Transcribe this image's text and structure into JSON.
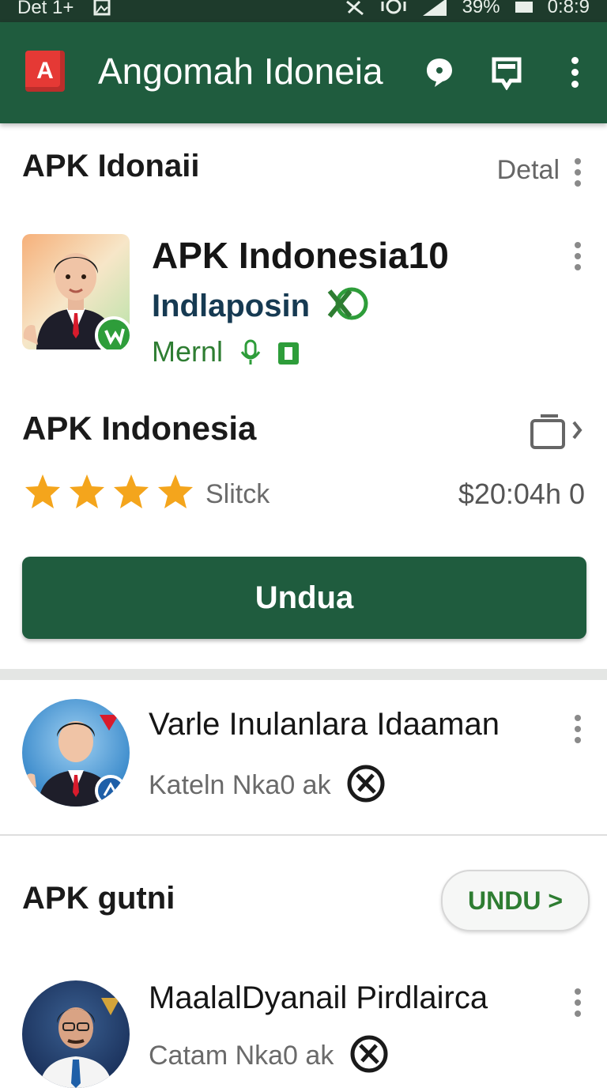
{
  "status_bar": {
    "carrier": "Det 1+",
    "battery": "39%",
    "time": "0:8:9"
  },
  "app_bar": {
    "logo_letter": "A",
    "title": "Angomah Idoneia",
    "icons": [
      "chat-icon",
      "bookmark-icon",
      "more-vert-icon"
    ]
  },
  "featured": {
    "section_title": "APK Idonaii",
    "detail_label": "Detal",
    "app_name": "APK Indonesia10",
    "developer": "Indlaposin",
    "category": "Mernl",
    "subtitle": "APK Indonesia",
    "rating_label": "Slitck",
    "rating_stars": 4,
    "price": "$20:04h 0",
    "download_label": "Undua"
  },
  "list_items": [
    {
      "title": "Varle Inulanlara Idaaman",
      "subtitle": "Kateln Nka0 ak"
    },
    {
      "title": "MaalalDyanail Pirdlairca",
      "subtitle": "Catam Nka0 ak"
    }
  ],
  "second_section": {
    "title": "APK gutni",
    "button_label": "UNDU >"
  },
  "colors": {
    "primary": "#1f5c3e",
    "accent_green": "#2e7d32",
    "star": "#f4a51c",
    "logo_red": "#e53935"
  }
}
